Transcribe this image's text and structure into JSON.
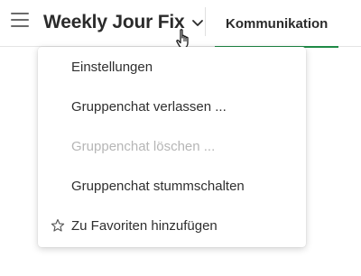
{
  "header": {
    "title": "Weekly Jour Fix",
    "tab_label": "Kommunikation",
    "accent_color": "#1f8a46",
    "menu_icon": "hamburger-menu-icon",
    "dropdown_icon": "chevron-down-icon"
  },
  "menu": {
    "items": [
      {
        "label": "Einstellungen",
        "enabled": true
      },
      {
        "label": "Gruppenchat verlassen ...",
        "enabled": true
      },
      {
        "label": "Gruppenchat löschen ...",
        "enabled": false
      },
      {
        "label": "Gruppenchat stummschalten",
        "enabled": true
      },
      {
        "label": "Zu Favoriten hinzufügen",
        "enabled": true,
        "icon": "star-outline-icon"
      }
    ]
  }
}
